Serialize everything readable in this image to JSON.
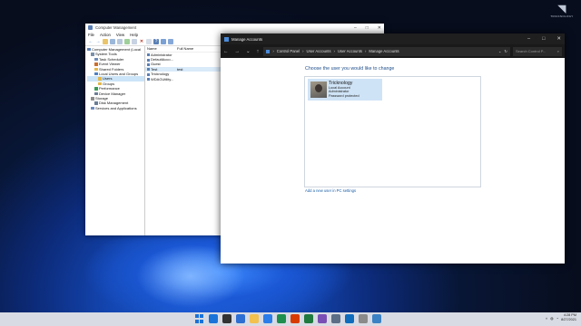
{
  "branding": {
    "logo_text": "TRICKNOLOGY"
  },
  "computer_management": {
    "title": "Computer Management",
    "menu": [
      "File",
      "Action",
      "View",
      "Help"
    ],
    "tree": [
      {
        "label": "Computer Management (Local",
        "indent": 0
      },
      {
        "label": "System Tools",
        "indent": 1
      },
      {
        "label": "Task Scheduler",
        "indent": 2
      },
      {
        "label": "Event Viewer",
        "indent": 2
      },
      {
        "label": "Shared Folders",
        "indent": 2
      },
      {
        "label": "Local Users and Groups",
        "indent": 2
      },
      {
        "label": "Users",
        "indent": 3
      },
      {
        "label": "Groups",
        "indent": 3
      },
      {
        "label": "Performance",
        "indent": 2
      },
      {
        "label": "Device Manager",
        "indent": 2
      },
      {
        "label": "Storage",
        "indent": 1
      },
      {
        "label": "Disk Management",
        "indent": 2
      },
      {
        "label": "Services and Applications",
        "indent": 1
      }
    ],
    "columns": [
      "Name",
      "Full Name"
    ],
    "rows": [
      {
        "name": "Administrator",
        "full": ""
      },
      {
        "name": "DefaultAcco...",
        "full": ""
      },
      {
        "name": "Guest",
        "full": ""
      },
      {
        "name": "Test",
        "full": "test"
      },
      {
        "name": "Tricknology",
        "full": ""
      },
      {
        "name": "WDAGUtility...",
        "full": ""
      }
    ]
  },
  "manage_accounts": {
    "title": "Manage Accounts",
    "breadcrumb": [
      "Control Panel",
      "User Accounts",
      "User Accounts",
      "Manage Accounts"
    ],
    "search_placeholder": "Search Control P...",
    "heading": "Choose the user you would like to change",
    "account": {
      "name": "Tricknology",
      "lines": [
        "Local Account",
        "Administrator",
        "Password protected"
      ]
    },
    "add_link": "Add a new user in PC settings"
  },
  "taskbar": {
    "time": "4:28 PM",
    "date": "8/27/2021",
    "app_colors": [
      "#1a73d9",
      "#333333",
      "#2d6fd2",
      "#f2c14e",
      "#2b7de9",
      "#1e8f4e",
      "#d83b01",
      "#1f7a3f",
      "#7a4fb5",
      "#5b6e86",
      "#0f6cbd",
      "#8a8a8a",
      "#3b82c4"
    ]
  }
}
